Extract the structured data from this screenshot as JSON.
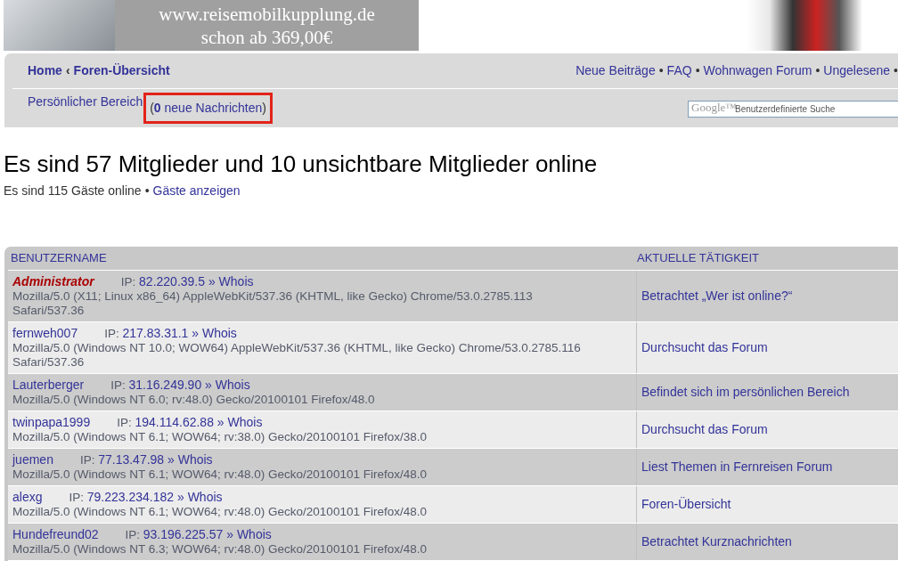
{
  "banner": {
    "url": "www.reisemobilkupplung.de",
    "price": "schon ab 369,00€"
  },
  "breadcrumbs": [
    {
      "label": "Home"
    },
    {
      "label": "‹"
    },
    {
      "label": "Foren-Übersicht"
    }
  ],
  "nav_links": [
    {
      "label": "Neue Beiträge"
    },
    {
      "label": "FAQ"
    },
    {
      "label": "Wohnwagen Forum"
    },
    {
      "label": "Ungelesene"
    }
  ],
  "nav_separator": "•",
  "personal": {
    "label": "Persönlicher Bereich",
    "open": "(",
    "count": "0",
    "messages": "neue Nachrichten",
    "close": ")"
  },
  "search": {
    "logo": "Google™",
    "placeholder": "Benutzerdefinierte Suche"
  },
  "heading": "Es sind 57 Mitglieder und 10 unsichtbare Mitglieder online",
  "guests": {
    "text": "Es sind 115 Gäste online",
    "separator": "•",
    "link": "Gäste anzeigen"
  },
  "table": {
    "columns": [
      "BENUTZERNAME",
      "AKTUELLE TÄTIGKEIT"
    ],
    "rows": [
      {
        "user": "Administrator",
        "kind": "admin",
        "color": "#aa0000",
        "ip_label": "IP:",
        "ip": "82.220.39.5",
        "whois": "» Whois",
        "agent": "Mozilla/5.0 (X11; Linux x86_64) AppleWebKit/537.36 (KHTML, like Gecko) Chrome/53.0.2785.113 Safari/537.36",
        "activity": "Betrachtet „Wer ist online?“"
      },
      {
        "user": "fernweh007",
        "kind": "member",
        "color": "#333399",
        "ip_label": "IP:",
        "ip": "217.83.31.1",
        "whois": "» Whois",
        "agent": "Mozilla/5.0 (Windows NT 10.0; WOW64) AppleWebKit/537.36 (KHTML, like Gecko) Chrome/53.0.2785.116 Safari/537.36",
        "activity": "Durchsucht das Forum"
      },
      {
        "user": "Lauterberger",
        "kind": "member",
        "color": "#333399",
        "ip_label": "IP:",
        "ip": "31.16.249.90",
        "whois": "» Whois",
        "agent": "Mozilla/5.0 (Windows NT 6.0; rv:48.0) Gecko/20100101 Firefox/48.0",
        "activity": "Befindet sich im persönlichen Bereich"
      },
      {
        "user": "twinpapa1999",
        "kind": "member",
        "color": "#333399",
        "ip_label": "IP:",
        "ip": "194.114.62.88",
        "whois": "» Whois",
        "agent": "Mozilla/5.0 (Windows NT 6.1; WOW64; rv:38.0) Gecko/20100101 Firefox/38.0",
        "activity": "Durchsucht das Forum"
      },
      {
        "user": "juemen",
        "kind": "member",
        "color": "#333399",
        "ip_label": "IP:",
        "ip": "77.13.47.98",
        "whois": "» Whois",
        "agent": "Mozilla/5.0 (Windows NT 6.1; WOW64; rv:48.0) Gecko/20100101 Firefox/48.0",
        "activity": "Liest Themen in Fernreisen Forum"
      },
      {
        "user": "alexg",
        "kind": "member",
        "color": "#333399",
        "ip_label": "IP:",
        "ip": "79.223.234.182",
        "whois": "» Whois",
        "agent": "Mozilla/5.0 (Windows NT 6.1; WOW64; rv:48.0) Gecko/20100101 Firefox/48.0",
        "activity": "Foren-Übersicht"
      },
      {
        "user": "Hundefreund02",
        "kind": "member",
        "color": "#333399",
        "ip_label": "IP:",
        "ip": "93.196.225.57",
        "whois": "» Whois",
        "agent": "Mozilla/5.0 (Windows NT 6.3; WOW64; rv:48.0) Gecko/20100101 Firefox/48.0",
        "activity": "Betrachtet Kurznachrichten"
      }
    ]
  }
}
